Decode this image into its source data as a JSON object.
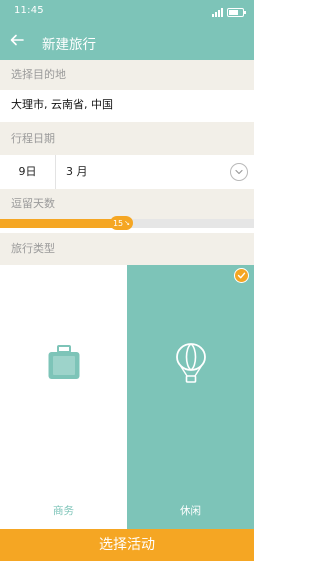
{
  "status_bar": {
    "time": "11:45",
    "signal_icon": "signal-icon",
    "battery_icon": "battery-icon"
  },
  "app_bar": {
    "title": "新建旅行",
    "back_icon": "arrow-left-icon"
  },
  "destination": {
    "header": "选择目的地",
    "value": "大理市, 云南省, 中国"
  },
  "dates": {
    "header": "行程日期",
    "day": "9日",
    "month": "3 月",
    "dropdown_icon": "chevron-down-icon"
  },
  "stay": {
    "header": "逗留天数",
    "days_label": "15",
    "days_suffix": "↘",
    "fraction": 0.48
  },
  "trip_type": {
    "header": "旅行类型",
    "options": [
      {
        "label": "商务",
        "icon": "briefcase-icon",
        "selected": false
      },
      {
        "label": "休闲",
        "icon": "hot-air-balloon-icon",
        "selected": true
      }
    ],
    "check_icon": "checkmark-icon"
  },
  "action": {
    "label": "选择活动"
  },
  "colors": {
    "teal": "#7dc4b8",
    "orange": "#f5a623",
    "section_bg": "#f2efe8"
  }
}
